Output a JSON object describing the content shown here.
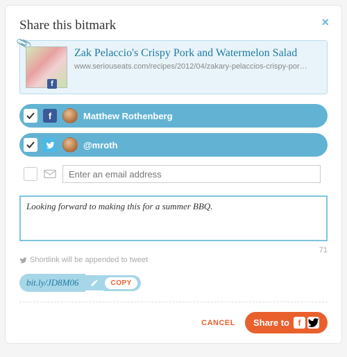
{
  "dialog": {
    "title": "Share this bitmark",
    "bitmark": {
      "title": "Zak Pelaccio's Crispy Pork and Watermelon Salad",
      "url": "www.seriouseats.com/recipes/2012/04/zakary-pelaccios-crispy-por…"
    },
    "recipients": [
      {
        "network": "facebook",
        "name": "Matthew Rothenberg",
        "checked": true
      },
      {
        "network": "twitter",
        "name": "@mroth",
        "checked": true
      }
    ],
    "email": {
      "placeholder": "Enter an email address",
      "value": ""
    },
    "message": {
      "value": "Looking forward to making this for a summer BBQ.",
      "counter": "71"
    },
    "hint": "Shortlink will be appended to tweet",
    "shortlink": {
      "url": "bit.ly/JD8M06",
      "copy_label": "COPY"
    },
    "actions": {
      "cancel": "CANCEL",
      "share": "Share to"
    }
  }
}
